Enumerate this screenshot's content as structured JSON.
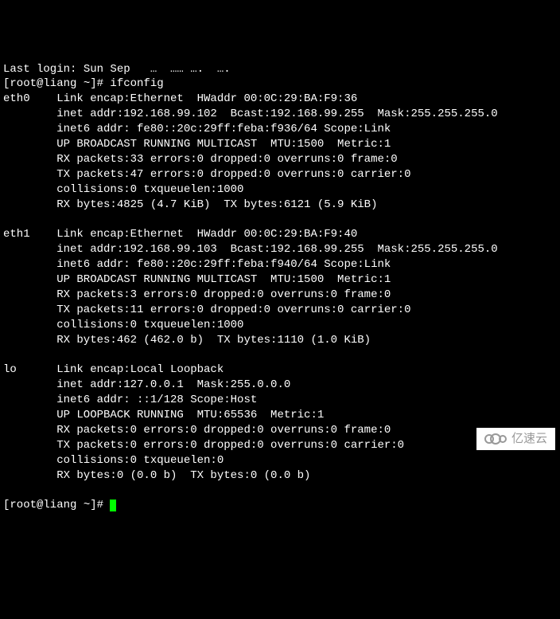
{
  "partial_top_line": "Last login: Sun Sep   …  …… ….  ….",
  "prompts": {
    "p1": "[root@liang ~]# ",
    "p2": "[root@liang ~]# "
  },
  "command": "ifconfig",
  "interfaces": [
    {
      "name": "eth0",
      "lines": [
        "Link encap:Ethernet  HWaddr 00:0C:29:BA:F9:36",
        "inet addr:192.168.99.102  Bcast:192.168.99.255  Mask:255.255.255.0",
        "inet6 addr: fe80::20c:29ff:feba:f936/64 Scope:Link",
        "UP BROADCAST RUNNING MULTICAST  MTU:1500  Metric:1",
        "RX packets:33 errors:0 dropped:0 overruns:0 frame:0",
        "TX packets:47 errors:0 dropped:0 overruns:0 carrier:0",
        "collisions:0 txqueuelen:1000",
        "RX bytes:4825 (4.7 KiB)  TX bytes:6121 (5.9 KiB)"
      ]
    },
    {
      "name": "eth1",
      "lines": [
        "Link encap:Ethernet  HWaddr 00:0C:29:BA:F9:40",
        "inet addr:192.168.99.103  Bcast:192.168.99.255  Mask:255.255.255.0",
        "inet6 addr: fe80::20c:29ff:feba:f940/64 Scope:Link",
        "UP BROADCAST RUNNING MULTICAST  MTU:1500  Metric:1",
        "RX packets:3 errors:0 dropped:0 overruns:0 frame:0",
        "TX packets:11 errors:0 dropped:0 overruns:0 carrier:0",
        "collisions:0 txqueuelen:1000",
        "RX bytes:462 (462.0 b)  TX bytes:1110 (1.0 KiB)"
      ]
    },
    {
      "name": "lo",
      "lines": [
        "Link encap:Local Loopback",
        "inet addr:127.0.0.1  Mask:255.0.0.0",
        "inet6 addr: ::1/128 Scope:Host",
        "UP LOOPBACK RUNNING  MTU:65536  Metric:1",
        "RX packets:0 errors:0 dropped:0 overruns:0 frame:0",
        "TX packets:0 errors:0 dropped:0 overruns:0 carrier:0",
        "collisions:0 txqueuelen:0",
        "RX bytes:0 (0.0 b)  TX bytes:0 (0.0 b)"
      ]
    }
  ],
  "watermark": {
    "text": "亿速云"
  }
}
